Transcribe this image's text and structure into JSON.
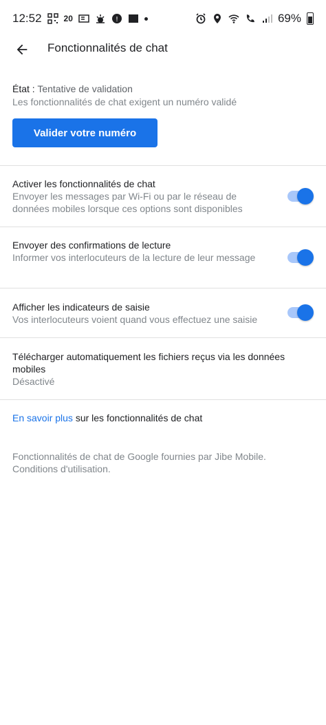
{
  "status_bar": {
    "time": "12:52",
    "battery": "69%",
    "badge_20": "20",
    "tv_label": "TV"
  },
  "header": {
    "title": "Fonctionnalités de chat"
  },
  "status_section": {
    "label": "État : ",
    "value": "Tentative de validation",
    "note": "Les fonctionnalités de chat exigent un numéro validé",
    "button_label": "Valider votre numéro"
  },
  "settings": [
    {
      "title": "Activer les fonctionnalités de chat",
      "desc": "Envoyer les messages par Wi-Fi ou par le réseau de données mobiles lorsque ces options sont disponibles",
      "enabled": true
    },
    {
      "title": "Envoyer des confirmations de lecture",
      "desc": "Informer vos interlocuteurs de la lecture de leur message",
      "enabled": true
    },
    {
      "title": "Afficher les indicateurs de saisie",
      "desc": "Vos interlocuteurs voient quand vous effectuez une saisie",
      "enabled": true
    }
  ],
  "auto_download": {
    "title": "Télécharger automatiquement les fichiers reçus via les données mobiles",
    "value": "Désactivé"
  },
  "learn_more": {
    "link_text": "En savoir plus",
    "rest_text": " sur les fonctionnalités de chat"
  },
  "footer": {
    "line1": "Fonctionnalités de chat de Google fournies par Jibe Mobile.",
    "line2": "Conditions d'utilisation."
  },
  "colors": {
    "accent": "#1a73e8",
    "toggle_track": "#a8c7fa",
    "divider": "#e0e0e0"
  }
}
